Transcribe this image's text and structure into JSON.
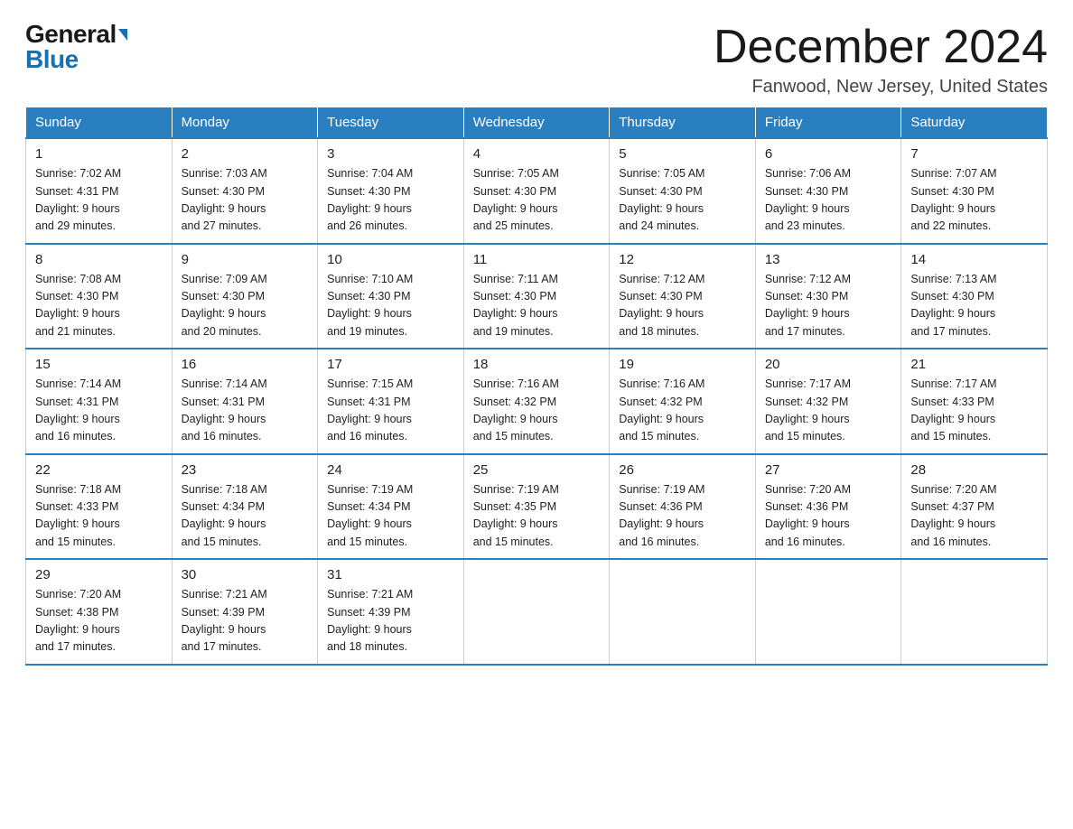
{
  "header": {
    "logo_general": "General",
    "logo_blue": "Blue",
    "month_title": "December 2024",
    "location": "Fanwood, New Jersey, United States"
  },
  "days_of_week": [
    "Sunday",
    "Monday",
    "Tuesday",
    "Wednesday",
    "Thursday",
    "Friday",
    "Saturday"
  ],
  "weeks": [
    [
      {
        "day": "1",
        "sunrise": "7:02 AM",
        "sunset": "4:31 PM",
        "daylight": "9 hours and 29 minutes."
      },
      {
        "day": "2",
        "sunrise": "7:03 AM",
        "sunset": "4:30 PM",
        "daylight": "9 hours and 27 minutes."
      },
      {
        "day": "3",
        "sunrise": "7:04 AM",
        "sunset": "4:30 PM",
        "daylight": "9 hours and 26 minutes."
      },
      {
        "day": "4",
        "sunrise": "7:05 AM",
        "sunset": "4:30 PM",
        "daylight": "9 hours and 25 minutes."
      },
      {
        "day": "5",
        "sunrise": "7:05 AM",
        "sunset": "4:30 PM",
        "daylight": "9 hours and 24 minutes."
      },
      {
        "day": "6",
        "sunrise": "7:06 AM",
        "sunset": "4:30 PM",
        "daylight": "9 hours and 23 minutes."
      },
      {
        "day": "7",
        "sunrise": "7:07 AM",
        "sunset": "4:30 PM",
        "daylight": "9 hours and 22 minutes."
      }
    ],
    [
      {
        "day": "8",
        "sunrise": "7:08 AM",
        "sunset": "4:30 PM",
        "daylight": "9 hours and 21 minutes."
      },
      {
        "day": "9",
        "sunrise": "7:09 AM",
        "sunset": "4:30 PM",
        "daylight": "9 hours and 20 minutes."
      },
      {
        "day": "10",
        "sunrise": "7:10 AM",
        "sunset": "4:30 PM",
        "daylight": "9 hours and 19 minutes."
      },
      {
        "day": "11",
        "sunrise": "7:11 AM",
        "sunset": "4:30 PM",
        "daylight": "9 hours and 19 minutes."
      },
      {
        "day": "12",
        "sunrise": "7:12 AM",
        "sunset": "4:30 PM",
        "daylight": "9 hours and 18 minutes."
      },
      {
        "day": "13",
        "sunrise": "7:12 AM",
        "sunset": "4:30 PM",
        "daylight": "9 hours and 17 minutes."
      },
      {
        "day": "14",
        "sunrise": "7:13 AM",
        "sunset": "4:30 PM",
        "daylight": "9 hours and 17 minutes."
      }
    ],
    [
      {
        "day": "15",
        "sunrise": "7:14 AM",
        "sunset": "4:31 PM",
        "daylight": "9 hours and 16 minutes."
      },
      {
        "day": "16",
        "sunrise": "7:14 AM",
        "sunset": "4:31 PM",
        "daylight": "9 hours and 16 minutes."
      },
      {
        "day": "17",
        "sunrise": "7:15 AM",
        "sunset": "4:31 PM",
        "daylight": "9 hours and 16 minutes."
      },
      {
        "day": "18",
        "sunrise": "7:16 AM",
        "sunset": "4:32 PM",
        "daylight": "9 hours and 15 minutes."
      },
      {
        "day": "19",
        "sunrise": "7:16 AM",
        "sunset": "4:32 PM",
        "daylight": "9 hours and 15 minutes."
      },
      {
        "day": "20",
        "sunrise": "7:17 AM",
        "sunset": "4:32 PM",
        "daylight": "9 hours and 15 minutes."
      },
      {
        "day": "21",
        "sunrise": "7:17 AM",
        "sunset": "4:33 PM",
        "daylight": "9 hours and 15 minutes."
      }
    ],
    [
      {
        "day": "22",
        "sunrise": "7:18 AM",
        "sunset": "4:33 PM",
        "daylight": "9 hours and 15 minutes."
      },
      {
        "day": "23",
        "sunrise": "7:18 AM",
        "sunset": "4:34 PM",
        "daylight": "9 hours and 15 minutes."
      },
      {
        "day": "24",
        "sunrise": "7:19 AM",
        "sunset": "4:34 PM",
        "daylight": "9 hours and 15 minutes."
      },
      {
        "day": "25",
        "sunrise": "7:19 AM",
        "sunset": "4:35 PM",
        "daylight": "9 hours and 15 minutes."
      },
      {
        "day": "26",
        "sunrise": "7:19 AM",
        "sunset": "4:36 PM",
        "daylight": "9 hours and 16 minutes."
      },
      {
        "day": "27",
        "sunrise": "7:20 AM",
        "sunset": "4:36 PM",
        "daylight": "9 hours and 16 minutes."
      },
      {
        "day": "28",
        "sunrise": "7:20 AM",
        "sunset": "4:37 PM",
        "daylight": "9 hours and 16 minutes."
      }
    ],
    [
      {
        "day": "29",
        "sunrise": "7:20 AM",
        "sunset": "4:38 PM",
        "daylight": "9 hours and 17 minutes."
      },
      {
        "day": "30",
        "sunrise": "7:21 AM",
        "sunset": "4:39 PM",
        "daylight": "9 hours and 17 minutes."
      },
      {
        "day": "31",
        "sunrise": "7:21 AM",
        "sunset": "4:39 PM",
        "daylight": "9 hours and 18 minutes."
      },
      null,
      null,
      null,
      null
    ]
  ],
  "labels": {
    "sunrise": "Sunrise:",
    "sunset": "Sunset:",
    "daylight": "Daylight:"
  }
}
